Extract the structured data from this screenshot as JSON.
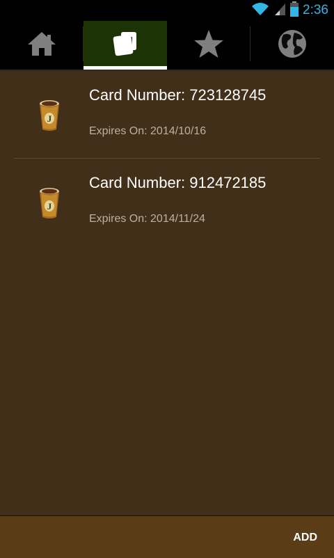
{
  "status_bar": {
    "time": "2:36",
    "icons": [
      "wifi-icon",
      "signal-icon",
      "battery-icon"
    ]
  },
  "tabs": [
    {
      "name": "home",
      "icon": "home-icon",
      "selected": false
    },
    {
      "name": "cards",
      "icon": "cards-icon",
      "selected": true
    },
    {
      "name": "favorites",
      "icon": "star-icon",
      "selected": false
    },
    {
      "name": "globe",
      "icon": "globe-icon",
      "selected": false
    }
  ],
  "cards": [
    {
      "number": "Card Number: 723128745",
      "expires": "Expires On: 2014/10/16",
      "icon": "coffee-cup-icon"
    },
    {
      "number": "Card Number: 912472185",
      "expires": "Expires On: 2014/11/24",
      "icon": "coffee-cup-icon"
    }
  ],
  "bottom_bar": {
    "add_label": "ADD"
  },
  "colors": {
    "background": "#412f19",
    "selected_tab": "#1c3305",
    "bottom_bar": "#5a3c16",
    "clock": "#33b5e5"
  }
}
